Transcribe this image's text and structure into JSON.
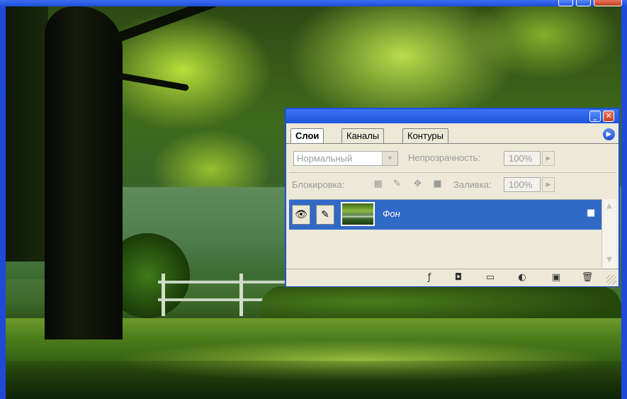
{
  "palette": {
    "tabs": [
      "Слои",
      "Каналы",
      "Контуры"
    ],
    "blend_mode": "Нормальный",
    "opacity_label": "Непрозрачность:",
    "opacity_value": "100%",
    "lock_label": "Блокировка:",
    "fill_label": "Заливка:",
    "fill_value": "100%",
    "layers": [
      {
        "name": "Фон",
        "selected": true,
        "locked": true,
        "visible": true
      }
    ]
  },
  "icons": {
    "window_min": "minimize-icon",
    "window_max": "maximize-icon",
    "window_close": "close-icon",
    "palette_menu": "palette-menu-arrow-icon",
    "eye": "eye-icon",
    "brush": "brush-icon",
    "lock": "lock-icon",
    "bottom": [
      "layer-style-icon",
      "mask-icon",
      "new-group-icon",
      "adjustment-layer-icon",
      "new-layer-icon",
      "trash-icon"
    ]
  },
  "colors": {
    "titlebar": "#1d55e0",
    "selection": "#3169c6",
    "panel": "#ece9d8"
  }
}
